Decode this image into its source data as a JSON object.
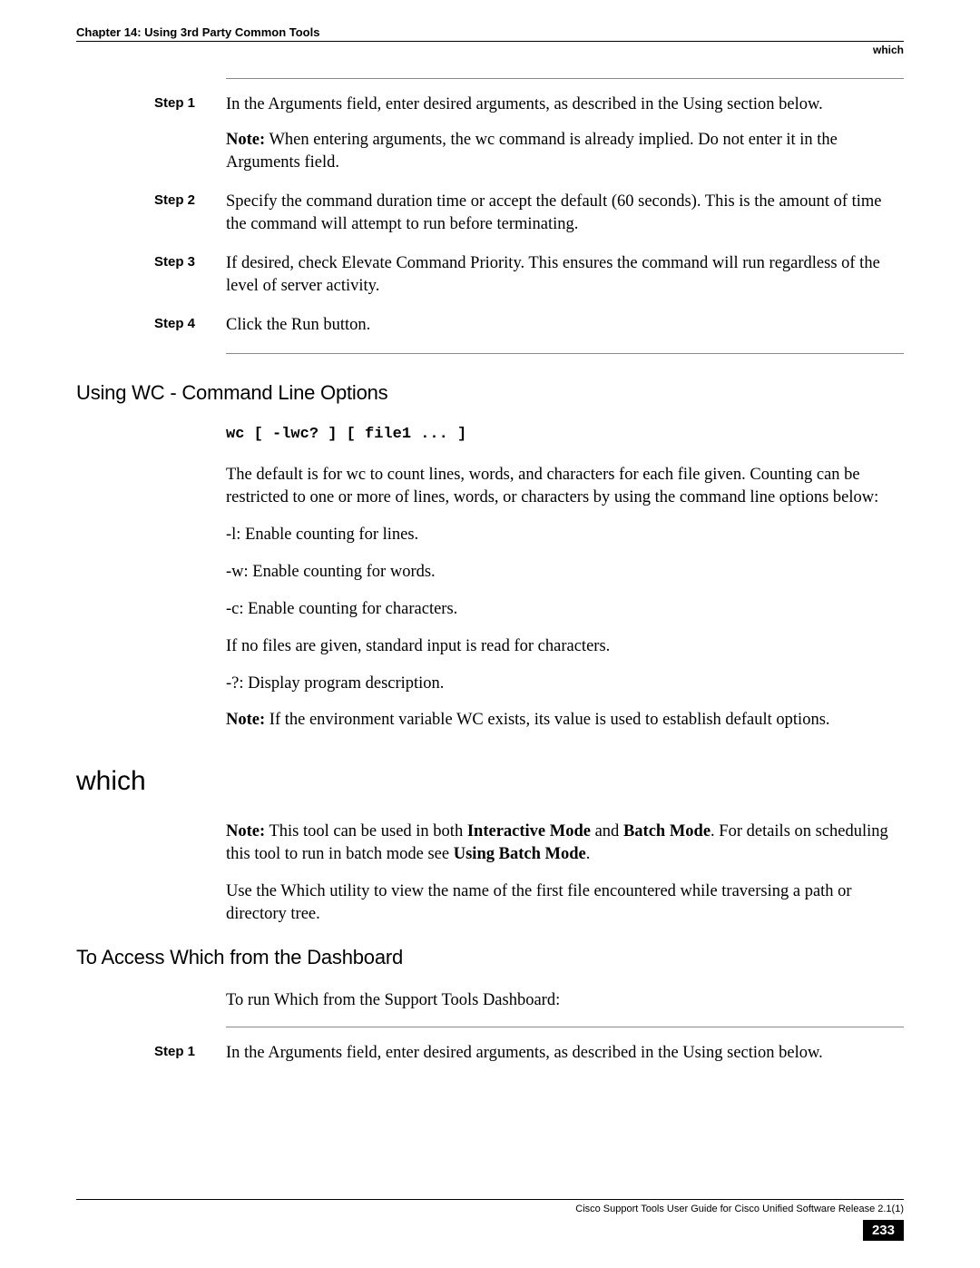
{
  "header": {
    "chapter": "Chapter 14: Using 3rd Party Common Tools",
    "section_right": "which"
  },
  "steps_block1": [
    {
      "label": "Step 1",
      "paras": [
        {
          "kind": "plain",
          "text": "In the Arguments field, enter desired arguments, as described in the Using section below."
        },
        {
          "kind": "note",
          "bold": "Note:",
          "text": " When entering arguments, the wc command is already implied. Do not enter it in the Arguments field."
        }
      ]
    },
    {
      "label": "Step 2",
      "paras": [
        {
          "kind": "plain",
          "text": "Specify the command duration time or accept the default (60 seconds). This is the amount of time the command will attempt to run before terminating."
        }
      ]
    },
    {
      "label": "Step 3",
      "paras": [
        {
          "kind": "plain",
          "text": "If desired, check Elevate Command Priority. This ensures the command will run regardless of the level of server activity."
        }
      ]
    },
    {
      "label": "Step 4",
      "paras": [
        {
          "kind": "plain",
          "text": "Click the Run button."
        }
      ]
    }
  ],
  "wc_section": {
    "heading": "Using WC - Command Line Options",
    "code": "wc [ -lwc? ] [ file1 ... ]",
    "paras": [
      "The default is for wc to count lines, words, and characters for each file given. Counting can be restricted to one or more of lines, words, or characters by using the command line options below:",
      "-l: Enable counting for lines.",
      "-w: Enable counting for words.",
      "-c: Enable counting for characters.",
      "If no files are given, standard input is read for characters.",
      "-?: Display program description."
    ],
    "note_bold": "Note:",
    "note_text": " If the environment variable WC exists, its value is used to establish default options."
  },
  "which_section": {
    "heading": "which",
    "note_bold": "Note:",
    "note_pre": " This tool can be used in both ",
    "note_b1": "Interactive Mode",
    "note_mid": " and ",
    "note_b2": "Batch Mode",
    "note_post1": ". For details on scheduling this tool to run in batch mode see ",
    "note_b3": "Using Batch Mode",
    "note_post2": ".",
    "desc": "Use the Which utility to view the name of the first file encountered while traversing a path or directory tree.",
    "sub_heading": "To Access Which from the Dashboard",
    "sub_intro": "To run Which from the Support Tools Dashboard:",
    "steps": [
      {
        "label": "Step 1",
        "text": "In the Arguments field, enter desired arguments, as described in the Using section below."
      }
    ]
  },
  "footer": {
    "title": "Cisco Support Tools User Guide for Cisco Unified Software Release 2.1(1)",
    "page": "233"
  }
}
